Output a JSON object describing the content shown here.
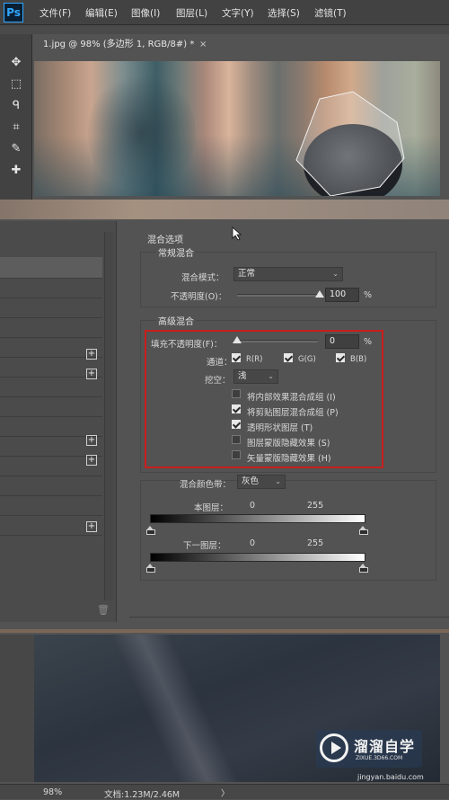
{
  "app": {
    "logo": "Ps"
  },
  "menu": [
    "文件(F)",
    "编辑(E)",
    "图像(I)",
    "图层(L)",
    "文字(Y)",
    "选择(S)",
    "滤镜(T)"
  ],
  "document_tab": {
    "title": "1.jpg @ 98% (多边形 1, RGB/8#) *",
    "close": "×"
  },
  "tools": [
    "move-icon",
    "marquee-icon",
    "lasso-icon",
    "crop-icon",
    "eyedropper-icon",
    "healing-icon"
  ],
  "dialog": {
    "title": "混合选项",
    "general": {
      "heading": "常规混合",
      "blend_mode_label": "混合模式：",
      "blend_mode_value": "正常",
      "opacity_label": "不透明度(O)：",
      "opacity_value": "100",
      "opacity_unit": "%",
      "opacity_level": 1.0
    },
    "advanced": {
      "heading": "高级混合",
      "fill_label": "填充不透明度(F)：",
      "fill_value": "0",
      "fill_unit": "%",
      "fill_level": 0.0,
      "channels_label": "通道：",
      "channels": [
        {
          "label": "R(R)",
          "checked": true
        },
        {
          "label": "G(G)",
          "checked": true
        },
        {
          "label": "B(B)",
          "checked": true
        }
      ],
      "knockout_label": "挖空：",
      "knockout_value": "浅",
      "options": [
        {
          "label": "将内部效果混合成组 (I)",
          "checked": false
        },
        {
          "label": "将剪贴图层混合成组 (P)",
          "checked": true
        },
        {
          "label": "透明形状图层 (T)",
          "checked": true
        },
        {
          "label": "图层蒙版隐藏效果 (S)",
          "checked": false
        },
        {
          "label": "矢量蒙版隐藏效果 (H)",
          "checked": false
        }
      ]
    },
    "blend_if": {
      "label": "混合颜色带：",
      "value": "灰色",
      "this_layer": {
        "label": "本图层：",
        "low": "0",
        "high": "255"
      },
      "underlying": {
        "label": "下一图层：",
        "low": "0",
        "high": "255"
      }
    }
  },
  "status": {
    "zoom": "98%",
    "doc_size": "文档:1.23M/2.46M",
    "arrow": "〉"
  },
  "watermark": {
    "brand": "溜溜自学",
    "site": "ZIXUE.3D66.COM",
    "source": "jingyan.baidu.com"
  },
  "colors": {
    "highlight": "#c81e1e",
    "ps_blue": "#31a8ff"
  }
}
